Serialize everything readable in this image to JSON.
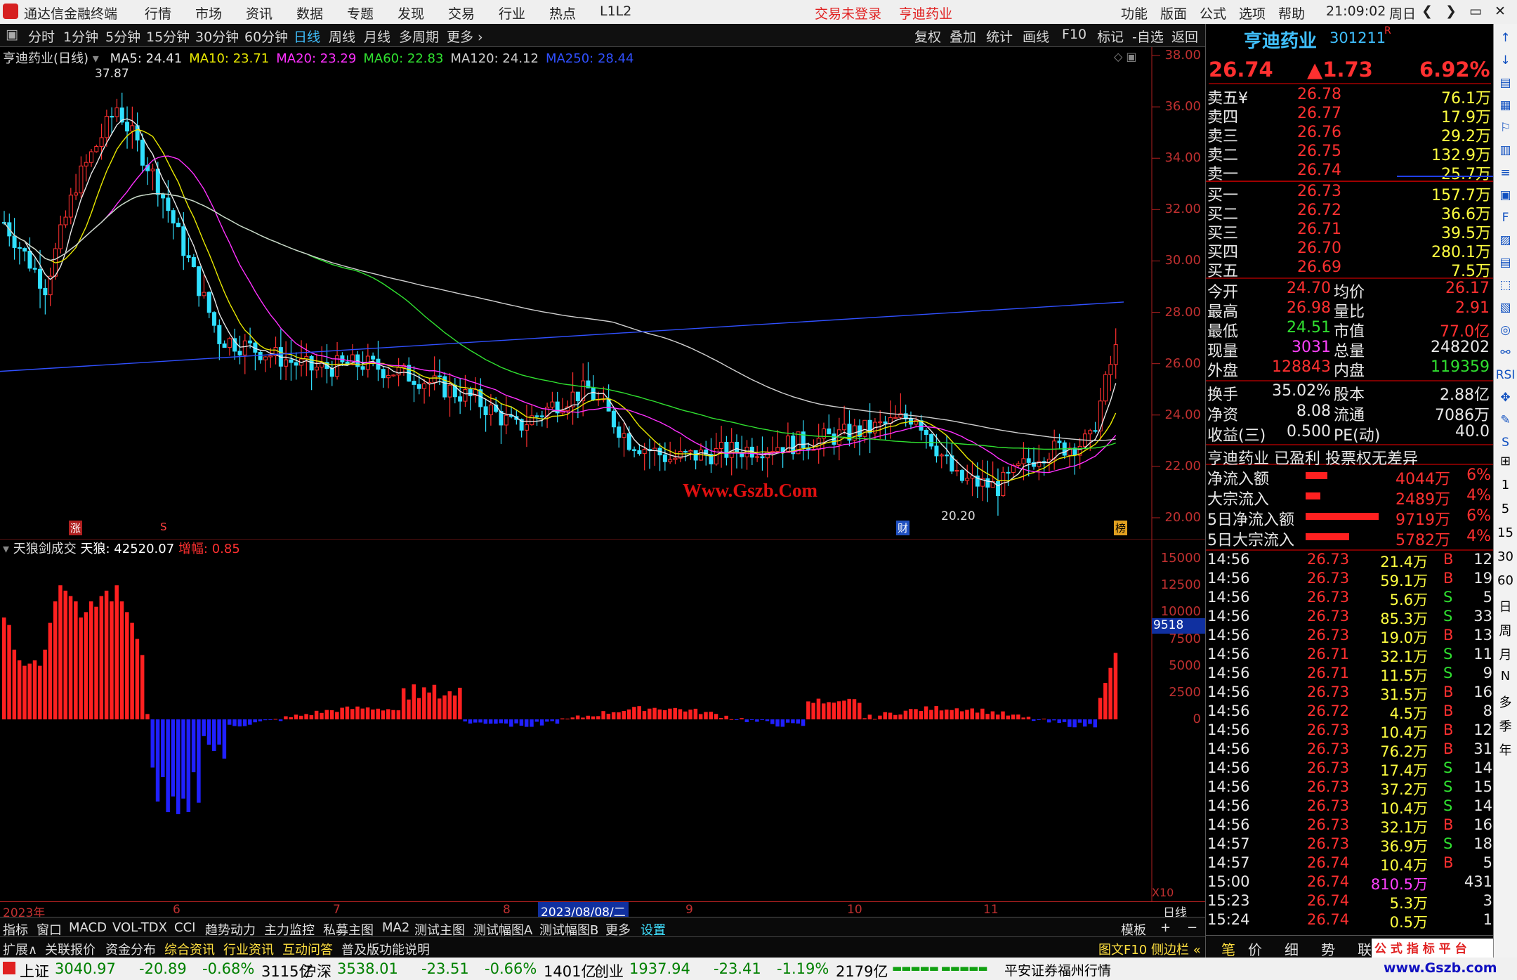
{
  "app": {
    "title": "通达信金融终端",
    "nav": [
      "行情",
      "市场",
      "资讯",
      "数据",
      "专题",
      "发现",
      "交易",
      "行业",
      "热点",
      "L1L2"
    ],
    "status_login": "交易未登录",
    "status_stock": "亨迪药业",
    "right_menu": [
      "功能",
      "版面",
      "公式",
      "选项",
      "帮助"
    ],
    "time": "21:09:02",
    "weekday": "周日",
    "win_controls": [
      "❮",
      "❯",
      "▭",
      "✕"
    ]
  },
  "timeframes": {
    "items": [
      "分时",
      "1分钟",
      "5分钟",
      "15分钟",
      "30分钟",
      "60分钟",
      "日线",
      "周线",
      "月线",
      "多周期",
      "更多 ›"
    ],
    "active": "日线",
    "tools": [
      "复权",
      "叠加",
      "统计",
      "画线",
      "F10",
      "标记",
      "-自选",
      "返回"
    ]
  },
  "chart": {
    "title": "亨迪药业(日线)",
    "ma": [
      {
        "label": "MA5: 24.41",
        "color": "#e8e8e8"
      },
      {
        "label": "MA10: 23.71",
        "color": "#e8e800"
      },
      {
        "label": "MA20: 23.29",
        "color": "#ff30ff"
      },
      {
        "label": "MA60: 22.83",
        "color": "#30e030"
      },
      {
        "label": "MA120: 24.12",
        "color": "#d0d0d0"
      },
      {
        "label": "MA250: 28.44",
        "color": "#3050ff"
      }
    ],
    "hi_label": "37.87",
    "lo_label": "20.20",
    "watermark": "Www.Gszb.Com",
    "markers": {
      "zhang": "涨",
      "s": "S",
      "cai": "财",
      "bang": "榜"
    }
  },
  "sub": {
    "name": "天狼剑成交",
    "value_label": "天狼: 42520.07",
    "amp_label": "增幅: 0.85",
    "cur_box": "9518",
    "x10": "X10"
  },
  "dates": {
    "labels": [
      "2023年",
      "6",
      "7",
      "8",
      "9",
      "10",
      "11"
    ],
    "hl": "2023/08/08/二",
    "right": "日线"
  },
  "bottom_tabs": [
    "指标",
    "窗口",
    "MACD",
    "VOL-TDX",
    "CCI",
    "趋势动力",
    "主力监控",
    "私募主图",
    "MA2",
    "测试主图",
    "测试幅图A",
    "测试幅图B",
    "更多",
    "设置"
  ],
  "bottom_right": [
    "模板",
    "+",
    "−"
  ],
  "bottom_tabs2": [
    "扩展∧",
    "关联报价",
    "资金分布",
    "综合资讯",
    "行业资讯",
    "互动问答",
    "普及版功能说明"
  ],
  "bottom_right2": "图文F10 侧边栏 «",
  "chart_data": {
    "type": "candlestick",
    "y_axis": [
      "38.00",
      "36.00",
      "34.00",
      "32.00",
      "30.00",
      "28.00",
      "26.00",
      "24.00",
      "22.00",
      "20.00"
    ],
    "ylim": [
      20,
      38
    ],
    "sub_axis": [
      "15000",
      "12500",
      "10000",
      "7500",
      "5000",
      "2500",
      "0"
    ],
    "sub_ylim": [
      0,
      15000
    ],
    "hi": 37.87,
    "lo": 20.2
  },
  "quote": {
    "name": "亨迪药业",
    "code": "301211",
    "flag": "R",
    "price": "26.74",
    "chg": "▲1.73",
    "pct": "6.92%",
    "sells": [
      [
        "卖五¥",
        "26.78",
        "76.1万"
      ],
      [
        "卖四",
        "26.77",
        "17.9万"
      ],
      [
        "卖三",
        "26.76",
        "29.2万"
      ],
      [
        "卖二",
        "26.75",
        "132.9万"
      ],
      [
        "卖一",
        "26.74",
        "25.7万"
      ]
    ],
    "buys": [
      [
        "买一",
        "26.73",
        "157.7万"
      ],
      [
        "买二",
        "26.72",
        "36.6万"
      ],
      [
        "买三",
        "26.71",
        "39.5万"
      ],
      [
        "买四",
        "26.70",
        "280.1万"
      ],
      [
        "买五",
        "26.69",
        "7.5万"
      ]
    ],
    "stats1": [
      [
        "今开",
        "24.70",
        "均价",
        "26.17"
      ],
      [
        "最高",
        "26.98",
        "量比",
        "2.91"
      ],
      [
        "最低",
        "24.51",
        "市值",
        "77.0亿"
      ],
      [
        "现量",
        "3031",
        "总量",
        "248202"
      ],
      [
        "外盘",
        "128843",
        "内盘",
        "119359"
      ]
    ],
    "stats2": [
      [
        "换手",
        "35.02%",
        "股本",
        "2.88亿"
      ],
      [
        "净资",
        "8.08",
        "流通",
        "7086万"
      ],
      [
        "收益(三)",
        "0.500",
        "PE(动)",
        "40.0"
      ]
    ],
    "profile": "亨迪药业 已盈利 投票权无差异",
    "flows": [
      [
        "净流入额",
        "4044万",
        "6%",
        0.3
      ],
      [
        "大宗流入",
        "2489万",
        "4%",
        0.2
      ],
      [
        "5日净流入额",
        "9719万",
        "6%",
        1.0
      ],
      [
        "5日大宗流入",
        "5782万",
        "4%",
        0.6
      ]
    ],
    "ticks": [
      [
        "14:56",
        "26.73",
        "21.4万",
        "B",
        "12"
      ],
      [
        "14:56",
        "26.73",
        "59.1万",
        "B",
        "19"
      ],
      [
        "14:56",
        "26.73",
        "5.6万",
        "S",
        "5"
      ],
      [
        "14:56",
        "26.73",
        "85.3万",
        "S",
        "33"
      ],
      [
        "14:56",
        "26.73",
        "19.0万",
        "B",
        "13"
      ],
      [
        "14:56",
        "26.71",
        "32.1万",
        "S",
        "11"
      ],
      [
        "14:56",
        "26.71",
        "11.5万",
        "S",
        "9"
      ],
      [
        "14:56",
        "26.73",
        "31.5万",
        "B",
        "16"
      ],
      [
        "14:56",
        "26.72",
        "4.5万",
        "B",
        "8"
      ],
      [
        "14:56",
        "26.73",
        "10.4万",
        "B",
        "12"
      ],
      [
        "14:56",
        "26.73",
        "76.2万",
        "B",
        "31"
      ],
      [
        "14:56",
        "26.73",
        "17.4万",
        "S",
        "14"
      ],
      [
        "14:56",
        "26.73",
        "37.2万",
        "S",
        "15"
      ],
      [
        "14:56",
        "26.73",
        "10.4万",
        "S",
        "14"
      ],
      [
        "14:56",
        "26.73",
        "32.1万",
        "B",
        "16"
      ],
      [
        "14:57",
        "26.73",
        "36.9万",
        "S",
        "18"
      ],
      [
        "14:57",
        "26.74",
        "10.4万",
        "B",
        "5"
      ],
      [
        "15:00",
        "26.74",
        "810.5万",
        "",
        "431"
      ],
      [
        "15:23",
        "26.74",
        "5.3万",
        "",
        "3"
      ],
      [
        "15:24",
        "26.74",
        "0.5万",
        "",
        "1"
      ]
    ],
    "tabs": [
      "笔",
      "价",
      "细",
      "势",
      "联"
    ]
  },
  "side_tools": [
    "↑",
    "↓",
    "▤",
    "▦",
    "⚐",
    "▥",
    "≡",
    "▣",
    "F",
    "▨",
    "▤",
    "⬚",
    "▧",
    "◎",
    "⚯",
    "RSI",
    "✥",
    "✎",
    "S",
    "⊞",
    "1",
    "5",
    "15",
    "30",
    "60",
    "日",
    "周",
    "月",
    "N",
    "多",
    "季",
    "年"
  ],
  "index": {
    "items": [
      {
        "name": "上证",
        "val": "3040.97",
        "chg": "-20.89",
        "pct": "-0.68%",
        "amt": "3115亿"
      },
      {
        "name": "沪深",
        "val": "3538.01",
        "chg": "-23.51",
        "pct": "-0.66%",
        "amt": "1401亿"
      },
      {
        "name": "创业",
        "val": "1937.94",
        "chg": "-23.41",
        "pct": "-1.19%",
        "amt": "2179亿"
      }
    ],
    "broker": "平安证券福州行情",
    "wm": "公 式 指 标 平 台",
    "wm2": "www.Gszb.com"
  }
}
